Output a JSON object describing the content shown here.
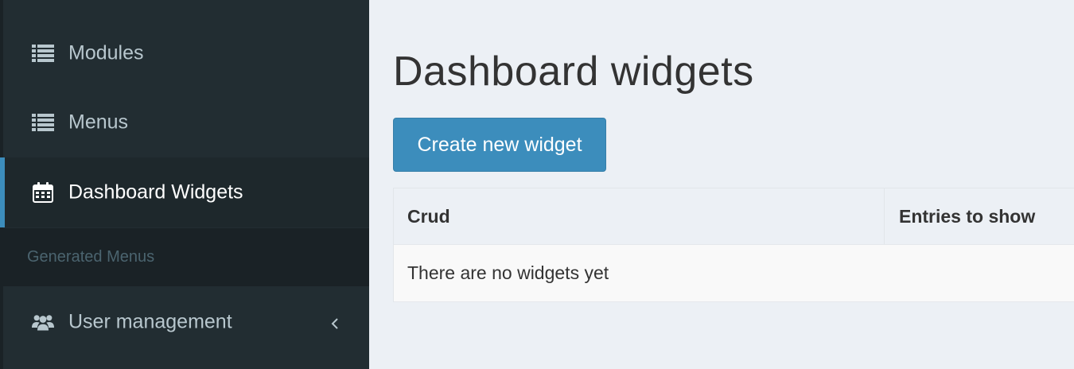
{
  "sidebar": {
    "items": [
      {
        "label": "Modules",
        "icon": "list-icon",
        "active": false
      },
      {
        "label": "Menus",
        "icon": "list-icon",
        "active": false
      },
      {
        "label": "Dashboard Widgets",
        "icon": "calendar-icon",
        "active": true
      }
    ],
    "header": "Generated Menus",
    "user_management": {
      "label": "User management",
      "icon": "users-icon"
    }
  },
  "main": {
    "title": "Dashboard widgets",
    "create_button": "Create new widget",
    "table": {
      "columns": [
        "Crud",
        "Entries to show"
      ],
      "empty_message": "There are no widgets yet"
    }
  },
  "colors": {
    "sidebar_bg": "#222d32",
    "sidebar_active_bg": "#1e282c",
    "accent": "#3c8dbc",
    "content_bg": "#ecf0f5"
  }
}
